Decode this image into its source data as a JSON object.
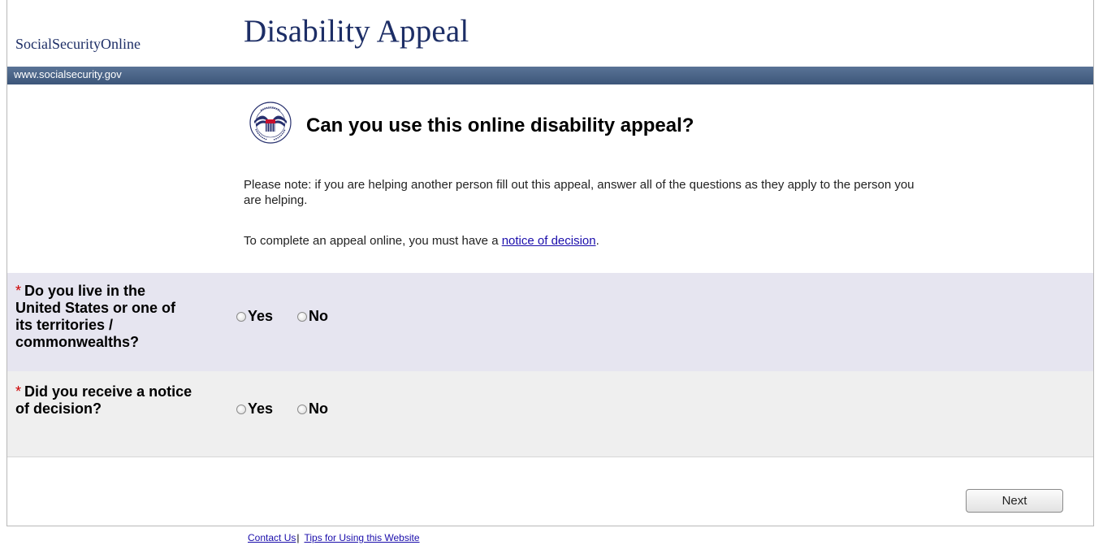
{
  "header": {
    "brand": "SocialSecurityOnline",
    "title": "Disability Appeal",
    "url_text": "www.socialsecurity.gov"
  },
  "logo": {
    "icon": "ssa-seal-icon",
    "seal_text": "SOCIAL SECURITY ADMINISTRATION",
    "seal_center": "USA"
  },
  "intro": {
    "heading": "Can you use this online disability appeal?",
    "note": "Please note: if you are helping another person fill out this appeal, answer all of the questions as they apply to the person you are helping.",
    "requirement_prefix": "To complete an appeal online, you must have a ",
    "requirement_link": "notice of decision",
    "requirement_suffix": "."
  },
  "questions": [
    {
      "required_mark": "*",
      "label": "Do you live in the United States or one of its territories / commonwealths?",
      "options": [
        "Yes",
        "No"
      ],
      "selected": null
    },
    {
      "required_mark": "*",
      "label": "Did you receive a notice of decision?",
      "options": [
        "Yes",
        "No"
      ],
      "selected": null
    }
  ],
  "actions": {
    "next_label": "Next"
  },
  "footer": {
    "contact_label": "Contact Us",
    "separator": "|",
    "tips_label": "Tips for Using this Website"
  },
  "colors": {
    "title_navy": "#1d2e66",
    "urlbar": "#4a6387",
    "row1_bg": "#e6e5f0",
    "row2_bg": "#efefef",
    "required_red": "#cc0000",
    "link_blue": "#1a0dab"
  }
}
